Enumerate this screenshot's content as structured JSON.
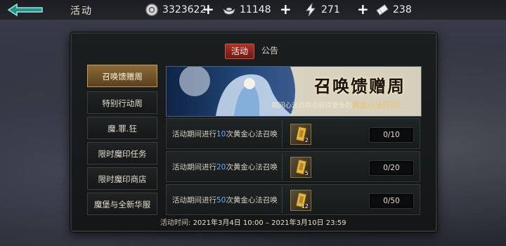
{
  "header": {
    "title": "活动",
    "resources": [
      {
        "icon": "coin-icon",
        "value": "3323622"
      },
      {
        "icon": "ingot-icon",
        "value": "11148"
      },
      {
        "icon": "stamina-icon",
        "value": "271"
      },
      {
        "icon": "ticket-icon",
        "value": "238"
      }
    ]
  },
  "tabs": [
    {
      "label": "活动",
      "active": true
    },
    {
      "label": "公告",
      "active": false
    }
  ],
  "sidebar": {
    "items": [
      {
        "label": "召唤馈赠周",
        "active": true
      },
      {
        "label": "特别行动周",
        "active": false
      },
      {
        "label": "魔.罪.狂",
        "active": false
      },
      {
        "label": "限时魔印任务",
        "active": false
      },
      {
        "label": "限时魔印商店",
        "active": false
      },
      {
        "label": "魔堡与全新华服",
        "active": false
      }
    ]
  },
  "banner": {
    "title": "召唤馈赠周",
    "subtitle_prefix": "期间心法召唤会获得更多的",
    "subtitle_highlight": "黄金心法符印!"
  },
  "tasks": [
    {
      "prefix": "活动期间进行",
      "number": "10",
      "suffix": "次黄金心法召唤",
      "reward_count": "2",
      "progress": "0/10"
    },
    {
      "prefix": "活动期间进行",
      "number": "20",
      "suffix": "次黄金心法召唤",
      "reward_count": "5",
      "progress": "0/20"
    },
    {
      "prefix": "活动期间进行",
      "number": "50",
      "suffix": "次黄金心法召唤",
      "reward_count": "12",
      "progress": "0/50"
    }
  ],
  "footer": {
    "label": "活动时间:",
    "time": "2021年3月4日 10:00 – 2021年3月10日 23:59"
  },
  "colors": {
    "accent_red": "#a8342c",
    "gold": "#c59a55",
    "number_blue": "#63b1ff"
  }
}
